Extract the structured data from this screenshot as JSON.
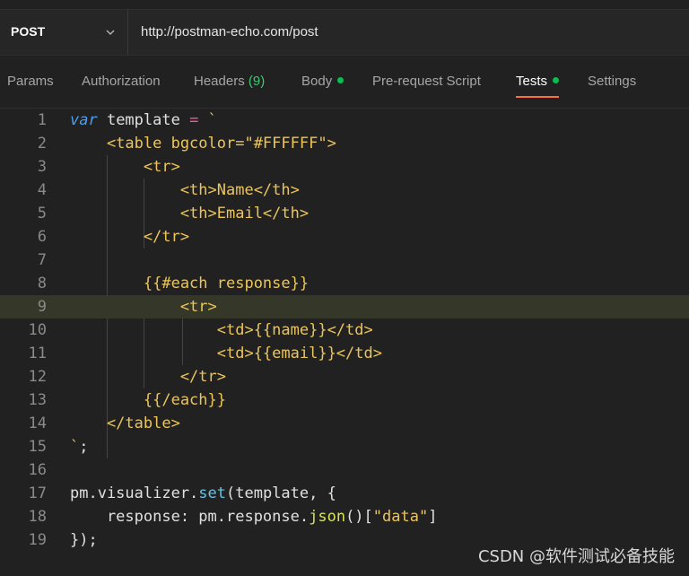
{
  "request": {
    "method": "POST",
    "url": "http://postman-echo.com/post"
  },
  "tabs": {
    "params": "Params",
    "authorization": "Authorization",
    "headers": "Headers",
    "headers_count": "(9)",
    "body": "Body",
    "prerequest": "Pre-request Script",
    "tests": "Tests",
    "settings": "Settings"
  },
  "editor": {
    "line_numbers": [
      "1",
      "2",
      "3",
      "4",
      "5",
      "6",
      "7",
      "8",
      "9",
      "10",
      "11",
      "12",
      "13",
      "14",
      "15",
      "16",
      "17",
      "18",
      "19"
    ],
    "l1": {
      "kw": "var",
      "name": " template ",
      "op": "=",
      "tick": " `"
    },
    "l2": "    <table bgcolor=\"#FFFFFF\">",
    "l3": "        <tr>",
    "l4": "            <th>Name</th>",
    "l5": "            <th>Email</th>",
    "l6": "        </tr>",
    "l7": "",
    "l8": "        {{#each response}}",
    "l9": "            <tr>",
    "l10": "                <td>{{name}}</td>",
    "l11": "                <td>{{email}}</td>",
    "l12": "            </tr>",
    "l13": "        {{/each}}",
    "l14": "    </table>",
    "l15": {
      "tick": "`",
      "rest": ";"
    },
    "l16": "",
    "l17": {
      "a": "pm.visualizer.",
      "fn": "set",
      "b": "(template, {"
    },
    "l18": {
      "a": "    response: pm.response.",
      "fn": "json",
      "b": "()[",
      "str": "\"data\"",
      "c": "]"
    },
    "l19": "});"
  },
  "watermark": "CSDN @软件测试必备技能"
}
